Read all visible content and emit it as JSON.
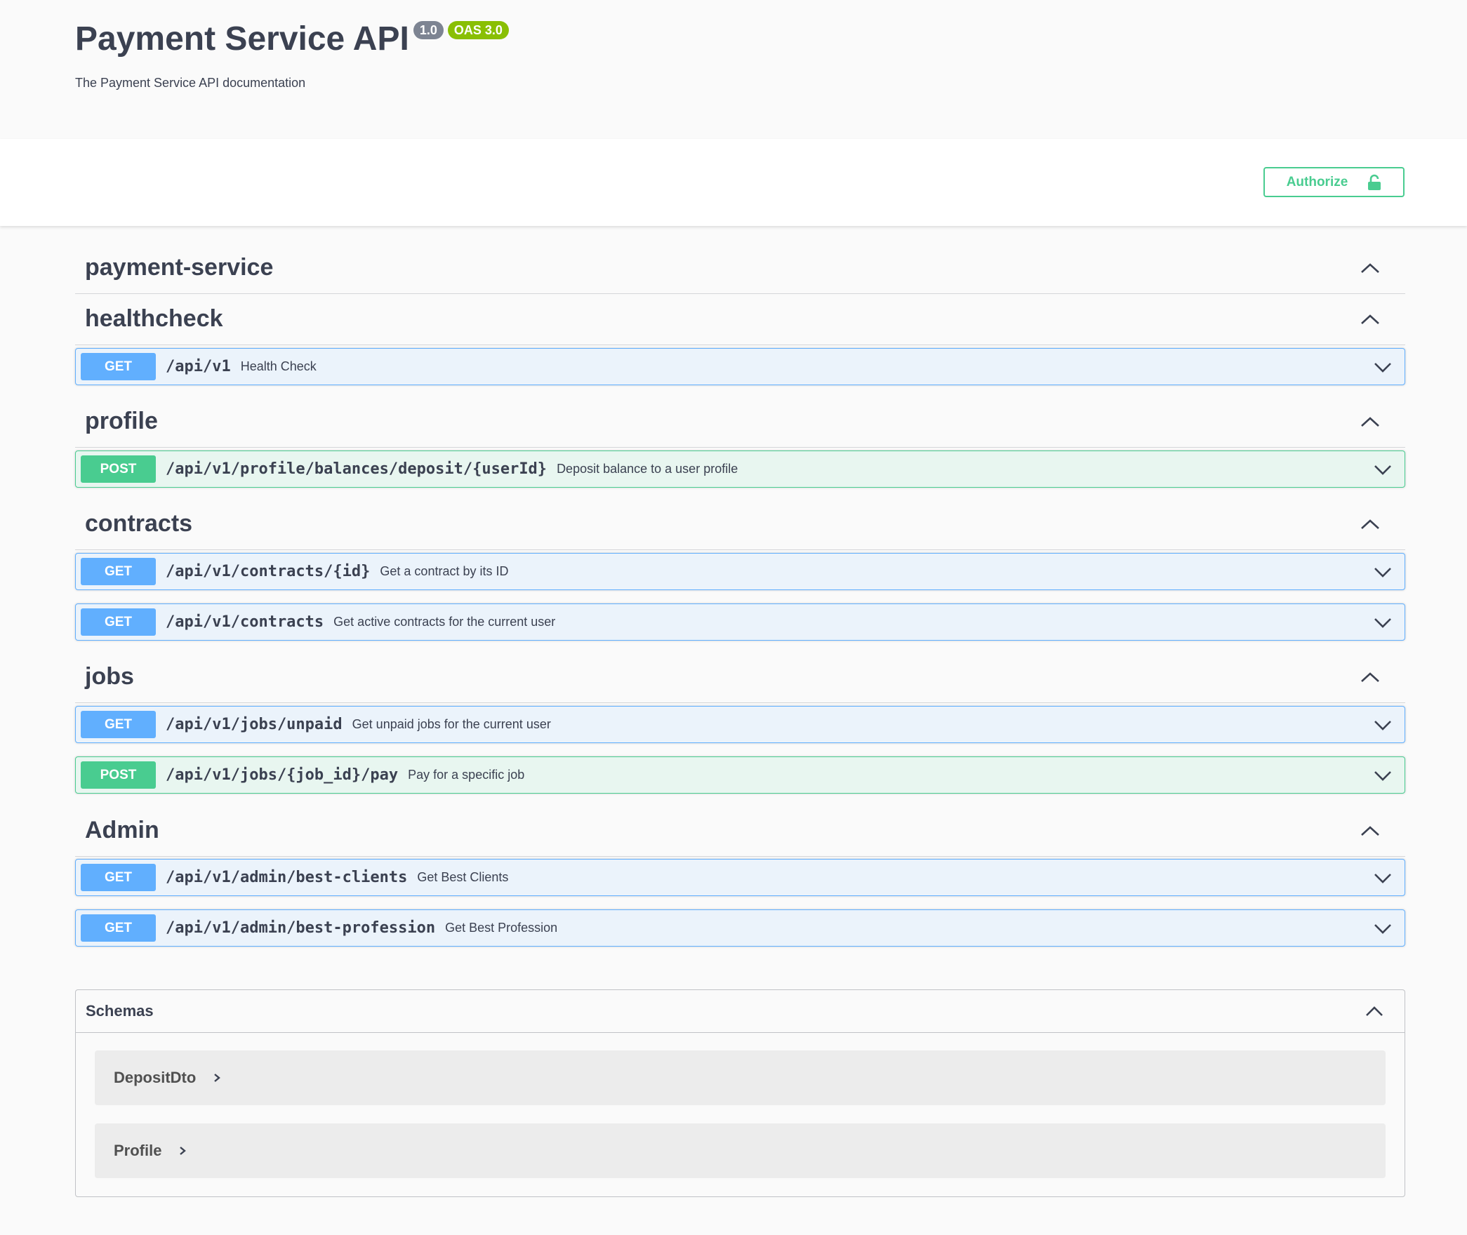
{
  "info": {
    "title": "Payment Service API",
    "version": "1.0",
    "oas": "OAS 3.0",
    "description": "The Payment Service API documentation"
  },
  "scheme": {
    "authorize_label": "Authorize",
    "authorize_icon": "lock-icon"
  },
  "colors": {
    "get": "#61affe",
    "post": "#49cc90",
    "text": "#3b4151"
  },
  "tags": [
    {
      "name": "payment-service",
      "operations": []
    },
    {
      "name": "healthcheck",
      "operations": [
        {
          "method": "GET",
          "path": "/api/v1",
          "summary": "Health Check"
        }
      ]
    },
    {
      "name": "profile",
      "operations": [
        {
          "method": "POST",
          "path": "/api/v1/profile/balances/deposit/{userId}",
          "summary": "Deposit balance to a user profile"
        }
      ]
    },
    {
      "name": "contracts",
      "operations": [
        {
          "method": "GET",
          "path": "/api/v1/contracts/{id}",
          "summary": "Get a contract by its ID"
        },
        {
          "method": "GET",
          "path": "/api/v1/contracts",
          "summary": "Get active contracts for the current user"
        }
      ]
    },
    {
      "name": "jobs",
      "operations": [
        {
          "method": "GET",
          "path": "/api/v1/jobs/unpaid",
          "summary": "Get unpaid jobs for the current user"
        },
        {
          "method": "POST",
          "path": "/api/v1/jobs/{job_id}/pay",
          "summary": "Pay for a specific job"
        }
      ]
    },
    {
      "name": "Admin",
      "operations": [
        {
          "method": "GET",
          "path": "/api/v1/admin/best-clients",
          "summary": "Get Best Clients"
        },
        {
          "method": "GET",
          "path": "/api/v1/admin/best-profession",
          "summary": "Get Best Profession"
        }
      ]
    }
  ],
  "schemas": {
    "title": "Schemas",
    "items": [
      "DepositDto",
      "Profile"
    ]
  }
}
